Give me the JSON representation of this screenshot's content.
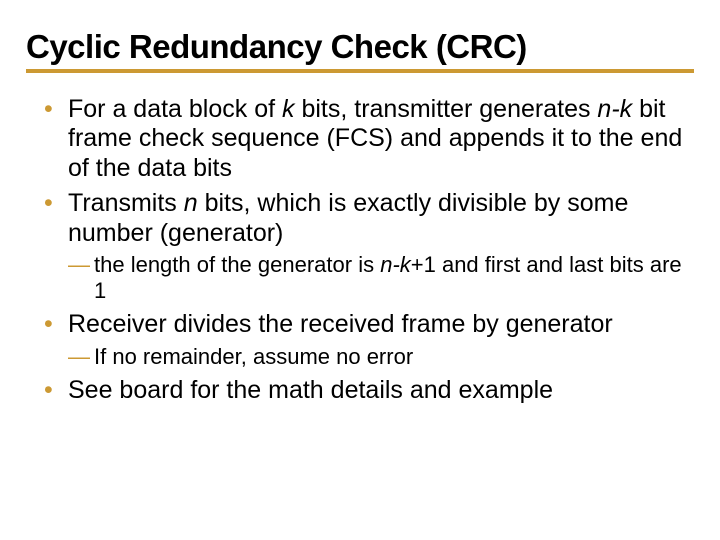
{
  "title": "Cyclic Redundancy Check (CRC)",
  "bullets": {
    "b1": {
      "pre1": "For a data block of ",
      "k": "k",
      "post1": " bits, transmitter generates ",
      "nk": "n-k",
      "post2": " bit frame check sequence (FCS) and appends it to the end of the data bits"
    },
    "b2": {
      "pre": "Transmits ",
      "n": "n",
      "post": " bits, which is exactly divisible by some number (generator)",
      "sub1": {
        "pre": "the length of the generator is ",
        "nk1": "n-k",
        "post": "+1 and first and last bits are 1"
      }
    },
    "b3": {
      "text": "Receiver divides the received frame by generator",
      "sub1": "If no remainder, assume no error"
    },
    "b4": "See board for the math details and example"
  }
}
